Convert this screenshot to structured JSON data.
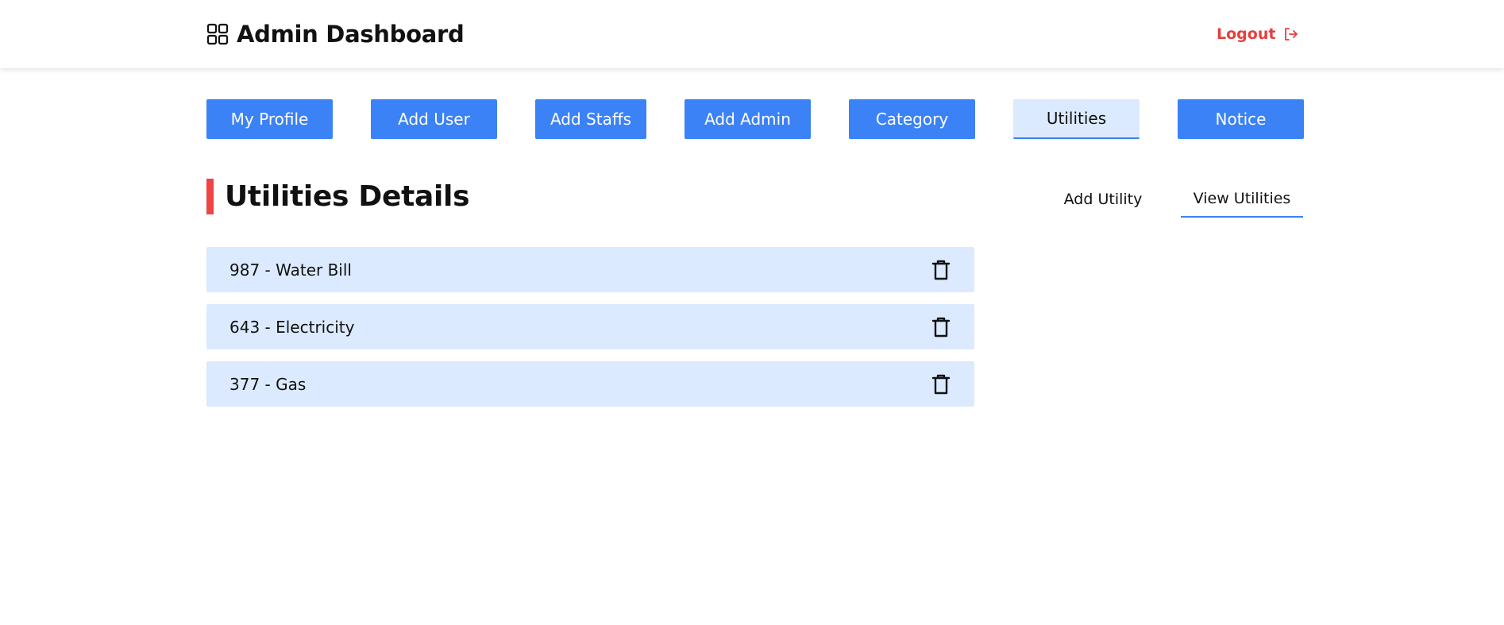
{
  "header": {
    "title": "Admin Dashboard",
    "logout_label": "Logout"
  },
  "nav": {
    "tabs": [
      {
        "label": "My Profile",
        "active": false
      },
      {
        "label": "Add User",
        "active": false
      },
      {
        "label": "Add Staffs",
        "active": false
      },
      {
        "label": "Add Admin",
        "active": false
      },
      {
        "label": "Category",
        "active": false
      },
      {
        "label": "Utilities",
        "active": true
      },
      {
        "label": "Notice",
        "active": false
      }
    ]
  },
  "section": {
    "title": "Utilities Details",
    "subtabs": [
      {
        "label": "Add Utility",
        "active": false
      },
      {
        "label": "View Utilities",
        "active": true
      }
    ]
  },
  "utilities": [
    {
      "label": "987 - Water Bill"
    },
    {
      "label": "643 - Electricity"
    },
    {
      "label": "377 - Gas"
    }
  ],
  "colors": {
    "primary": "#3b82f6",
    "primary_light": "#dbeafe",
    "accent_red": "#ef4444",
    "logout_red": "#e53e3e"
  },
  "icons": {
    "brand": "grid-icon",
    "logout": "logout-icon",
    "delete": "trash-icon"
  }
}
